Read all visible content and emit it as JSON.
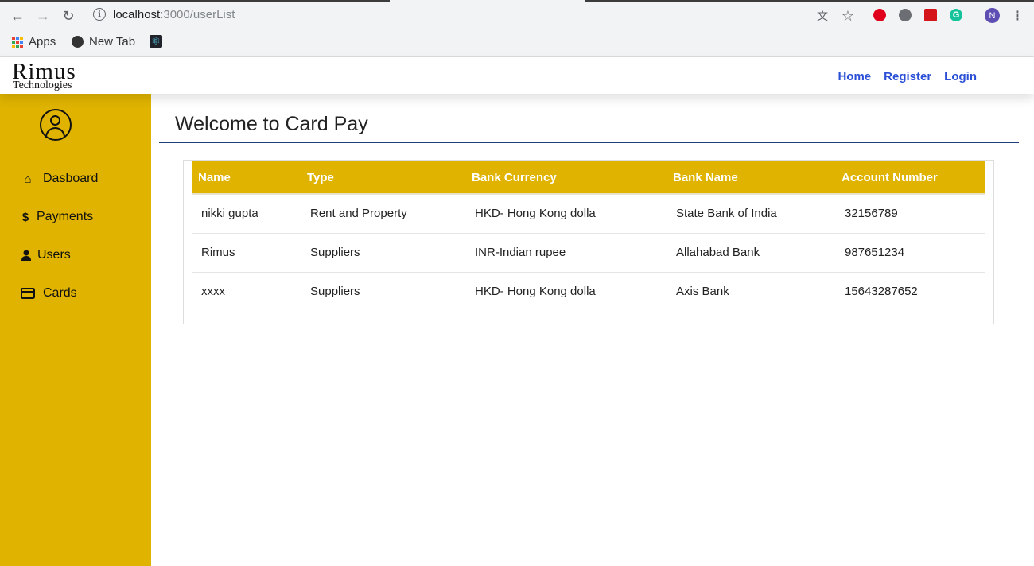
{
  "browser": {
    "url_host": "localhost",
    "url_path": ":3000/userList",
    "bookmarks": [
      {
        "label": "Apps",
        "icon": "apps-grid-icon"
      },
      {
        "label": "New Tab",
        "icon": "globe-icon"
      },
      {
        "label": "",
        "icon": "react-icon"
      }
    ],
    "profile_initial": "N"
  },
  "header": {
    "logo_main": "Rimus",
    "logo_sub": "Technologies",
    "nav": [
      "Home",
      "Register",
      "Login"
    ],
    "nav_color": "#2a4fd6"
  },
  "sidebar": {
    "color": "#dfb300",
    "items": [
      {
        "label": "Dasboard",
        "icon": "home-icon"
      },
      {
        "label": "Payments",
        "icon": "dollar-icon"
      },
      {
        "label": "Users",
        "icon": "user-icon"
      },
      {
        "label": "Cards",
        "icon": "credit-card-icon"
      }
    ]
  },
  "main": {
    "title": "Welcome to Card Pay",
    "table": {
      "headers": [
        "Name",
        "Type",
        "Bank Currency",
        "Bank Name",
        "Account Number"
      ],
      "rows": [
        [
          "nikki gupta",
          "Rent and Property",
          "HKD- Hong Kong dolla",
          "State Bank of India",
          "32156789"
        ],
        [
          "Rimus",
          "Suppliers",
          "INR-Indian rupee",
          "Allahabad Bank",
          "987651234"
        ],
        [
          "xxxx",
          "Suppliers",
          "HKD- Hong Kong dolla",
          "Axis Bank",
          "15643287652"
        ]
      ]
    }
  }
}
